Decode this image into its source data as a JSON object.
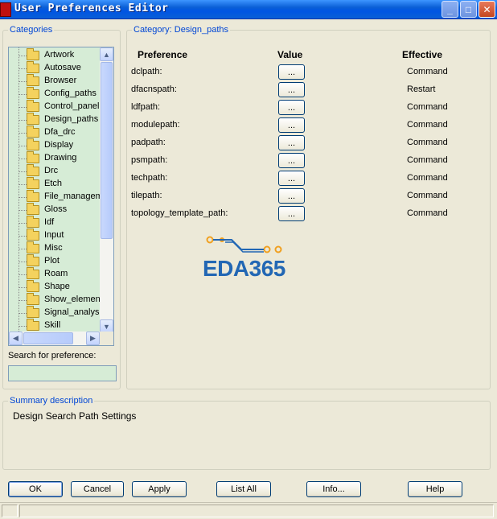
{
  "window": {
    "title": "User Preferences Editor"
  },
  "title_buttons": {
    "minimize": "_",
    "maximize": "□",
    "close": "✕"
  },
  "categories": {
    "legend": "Categories",
    "items": [
      "Artwork",
      "Autosave",
      "Browser",
      "Config_paths",
      "Control_panel",
      "Design_paths",
      "Dfa_drc",
      "Display",
      "Drawing",
      "Drc",
      "Etch",
      "File_managem",
      "Gloss",
      "Idf",
      "Input",
      "Misc",
      "Plot",
      "Roam",
      "Shape",
      "Show_elemen",
      "Signal_analysi",
      "Skill"
    ],
    "selected": "Design_paths"
  },
  "search": {
    "label": "Search for preference:",
    "value": ""
  },
  "category_panel": {
    "legend": "Category:  Design_paths",
    "headers": {
      "preference": "Preference",
      "value": "Value",
      "effective": "Effective"
    },
    "rows": [
      {
        "name": "dclpath:",
        "button": "...",
        "effective": "Command"
      },
      {
        "name": "dfacnspath:",
        "button": "...",
        "effective": "Restart"
      },
      {
        "name": "ldfpath:",
        "button": "...",
        "effective": "Command"
      },
      {
        "name": "modulepath:",
        "button": "...",
        "effective": "Command"
      },
      {
        "name": "padpath:",
        "button": "...",
        "effective": "Command"
      },
      {
        "name": "psmpath:",
        "button": "...",
        "effective": "Command"
      },
      {
        "name": "techpath:",
        "button": "...",
        "effective": "Command"
      },
      {
        "name": "tilepath:",
        "button": "...",
        "effective": "Command"
      },
      {
        "name": "topology_template_path:",
        "button": "...",
        "effective": "Command"
      }
    ]
  },
  "logo": {
    "text": "EDA365",
    "color": "#2267b4",
    "accent": "#f0a020"
  },
  "summary": {
    "legend": "Summary description",
    "text": "Design Search Path Settings"
  },
  "buttons": {
    "ok": "OK",
    "cancel": "Cancel",
    "apply": "Apply",
    "list_all": "List All",
    "info": "Info...",
    "help": "Help"
  }
}
